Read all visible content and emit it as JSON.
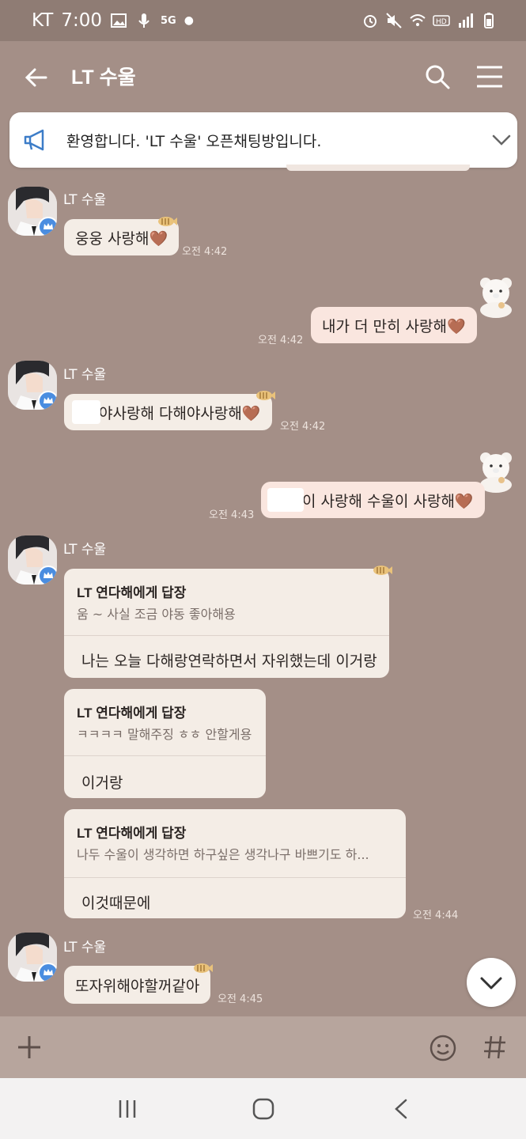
{
  "status": {
    "carrier": "KT",
    "time": "7:00",
    "network": "5G"
  },
  "header": {
    "title": "LT 수울"
  },
  "notice": {
    "text": "환영합니다. 'LT 수울' 오픈채팅방입니다."
  },
  "messages": {
    "m1": {
      "sender": "LT 수울",
      "text": "웅웅 사랑해🤎",
      "time": "오전 4:42"
    },
    "m2": {
      "text": "내가 더 만히 사랑해🤎",
      "time": "오전 4:42"
    },
    "m3": {
      "sender": "LT 수울",
      "text": "야사랑해 다해야사랑해🤎",
      "time": "오전 4:42"
    },
    "m4": {
      "text": "이 사랑해 수울이 사랑해🤎",
      "time": "오전 4:43"
    },
    "m5": {
      "sender": "LT 수울",
      "replies": [
        {
          "header": "LT 연다해에게 답장",
          "quote": "움 ~ 사실 조금 야동 좋아해용",
          "text": "나는 오늘 다해랑연락하면서 자위했는데 이거랑"
        },
        {
          "header": "LT 연다해에게 답장",
          "quote": "ㅋㅋㅋㅋ 말해주징 ㅎㅎ 안할게용",
          "text": "이거랑"
        },
        {
          "header": "LT 연다해에게 답장",
          "quote": "나두 수울이 생각하면 하구싶은 생각나구 바쁘기도 하...",
          "text": "이것때문에"
        }
      ],
      "time": "오전 4:44"
    },
    "m6": {
      "sender": "LT 수울",
      "text": "또자위해야할꺼같아",
      "time": "오전 4:45"
    }
  },
  "colors": {
    "background": "#a48f87",
    "bubble_other": "#f4ede6",
    "bubble_mine": "#fae6df",
    "input_bar": "#b7a59d"
  }
}
